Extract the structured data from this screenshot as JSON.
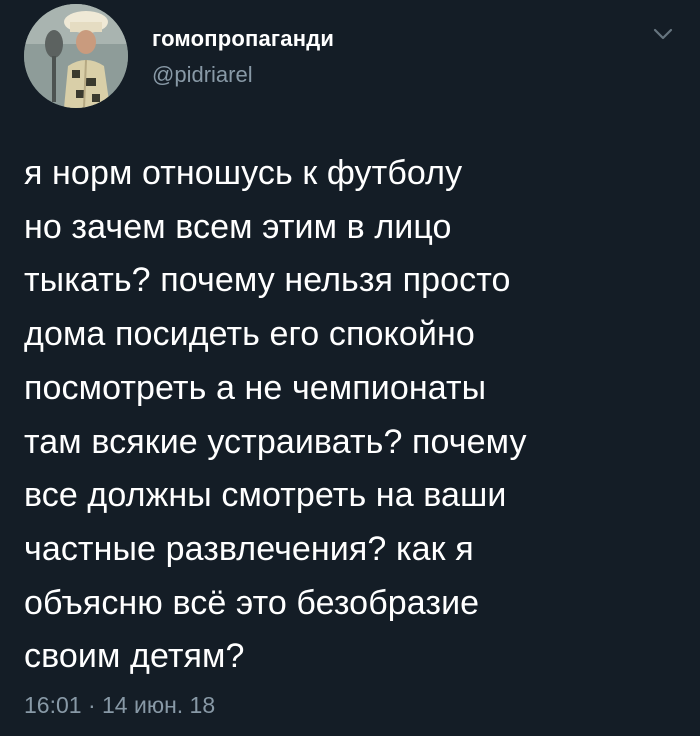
{
  "user": {
    "display_name": "гомопропаганди",
    "handle": "@pidriarel"
  },
  "tweet": {
    "text": "я норм отношусь к футболу\nно зачем всем этим в лицо\nтыкать? почему нельзя просто\nдома посидеть его спокойно\nпосмотреть а не чемпионаты\nтам всякие устраивать? почему\nвсе должны смотреть на ваши\nчастные развлечения? как я\nобъясню всё это безобразие\nсвоим детям?",
    "timestamp": "16:01 · 14 июн. 18"
  },
  "icons": {
    "menu": "chevron-down-icon"
  },
  "colors": {
    "background": "#141d26",
    "primary_text": "#ffffff",
    "secondary_text": "#8899a6"
  }
}
